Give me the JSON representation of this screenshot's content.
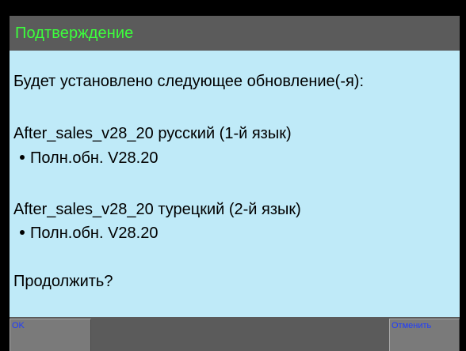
{
  "dialog": {
    "title": "Подтверждение",
    "intro": "Будет установлено следующее обновление(-я):",
    "updates": [
      {
        "package": "After_sales_v28_20 русский (1-й язык)",
        "item": "Полн.обн. V28.20"
      },
      {
        "package": "After_sales_v28_20 турецкий (2-й язык)",
        "item": "Полн.обн. V28.20"
      }
    ],
    "question": "Продолжить?"
  },
  "softkeys": {
    "left_label": "OK",
    "right_label": "Отменить"
  },
  "colors": {
    "title_text": "#3cff3c",
    "bar_background": "#5b5b5b",
    "content_background": "#bfeaf8",
    "softkey_text": "#1e3cff"
  }
}
